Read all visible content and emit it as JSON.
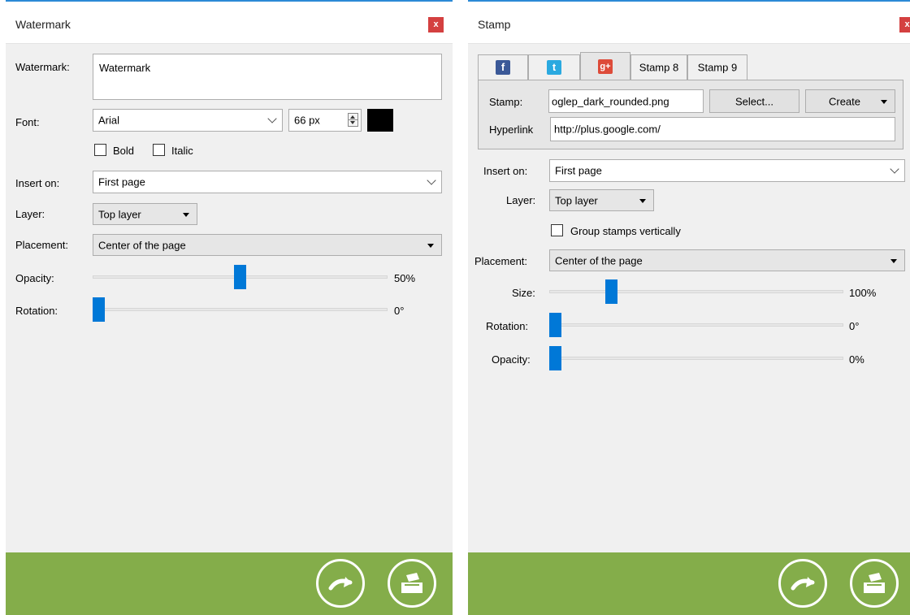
{
  "watermark_panel": {
    "title": "Watermark",
    "close_label": "x",
    "text_label": "Watermark:",
    "text_value": "Watermark",
    "font_label": "Font:",
    "font_value": "Arial",
    "font_size_value": "66 px",
    "font_color": "#000000",
    "bold_label": "Bold",
    "bold_checked": false,
    "italic_label": "Italic",
    "italic_checked": false,
    "insert_on_label": "Insert on:",
    "insert_on_value": "First page",
    "layer_label": "Layer:",
    "layer_value": "Top layer",
    "placement_label": "Placement:",
    "placement_value": "Center of the page",
    "opacity_label": "Opacity:",
    "opacity_value": "50%",
    "opacity_percent": 50,
    "rotation_label": "Rotation:",
    "rotation_value": "0°",
    "rotation_degrees": 0
  },
  "stamp_panel": {
    "title": "Stamp",
    "close_label": "x",
    "tabs": [
      {
        "icon": "facebook-icon",
        "glyph": "f",
        "color": "#3b5998",
        "selected": false
      },
      {
        "icon": "twitter-icon",
        "glyph": "t",
        "color": "#2aa9e0",
        "selected": false
      },
      {
        "icon": "google-plus-icon",
        "glyph": "g+",
        "color": "#dd4b39",
        "selected": true
      },
      {
        "label": "Stamp 8",
        "selected": false
      },
      {
        "label": "Stamp 9",
        "selected": false
      }
    ],
    "stamp_label": "Stamp:",
    "stamp_value": "oglep_dark_rounded.png",
    "select_button": "Select...",
    "create_button": "Create",
    "hyperlink_label": "Hyperlink",
    "hyperlink_value": "http://plus.google.com/",
    "insert_on_label": "Insert on:",
    "insert_on_value": "First page",
    "layer_label": "Layer:",
    "layer_value": "Top layer",
    "group_label": "Group stamps vertically",
    "group_checked": false,
    "placement_label": "Placement:",
    "placement_value": "Center of the page",
    "size_label": "Size:",
    "size_value": "100%",
    "size_percent": 100,
    "rotation_label": "Rotation:",
    "rotation_value": "0°",
    "rotation_degrees": 0,
    "opacity_label": "Opacity:",
    "opacity_value": "0%",
    "opacity_percent": 0
  },
  "footer": {
    "color": "#84ad4a",
    "buttons": [
      "forward-arrow-icon",
      "output-tray-icon"
    ]
  },
  "accent_color": "#0078d7",
  "close_color": "#d44040"
}
